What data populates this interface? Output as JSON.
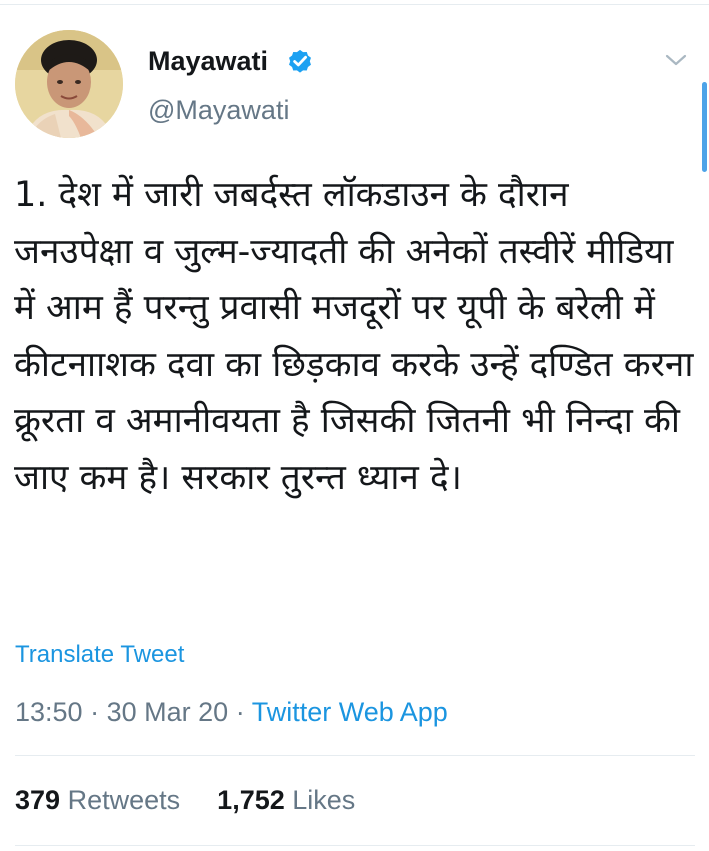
{
  "tweet": {
    "author": {
      "display_name": "Mayawati",
      "handle": "@Mayawati",
      "verified": true,
      "verified_icon": "verified-badge-icon",
      "avatar_icon": "profile-photo"
    },
    "menu_icon": "chevron-down-icon",
    "text": "1. देश में जारी जबर्दस्त लॉकडाउन के दौरान जनउपेक्षा व जुल्म-ज्यादती की अनेकों तस्वीरें मीडिया में आम हैं परन्तु प्रवासी मजदूरों पर यूपी के बरेली में कीटनााशक दवा का छिड़काव करके उन्हें दण्डित करना क्रूरता व अमानीवयता है जिसकी जितनी भी निन्दा की जाए कम है। सरकार तुरन्त ध्यान दे।",
    "translate_label": "Translate Tweet",
    "time": "13:50",
    "separator": "·",
    "date": "30 Mar 20",
    "source": "Twitter Web App",
    "retweets_count": "379",
    "retweets_label": "Retweets",
    "likes_count": "1,752",
    "likes_label": "Likes"
  },
  "colors": {
    "link": "#1b95e0",
    "text": "#14171a",
    "muted": "#657786",
    "divider": "#e6ecf0",
    "verified": "#1da1f2"
  }
}
